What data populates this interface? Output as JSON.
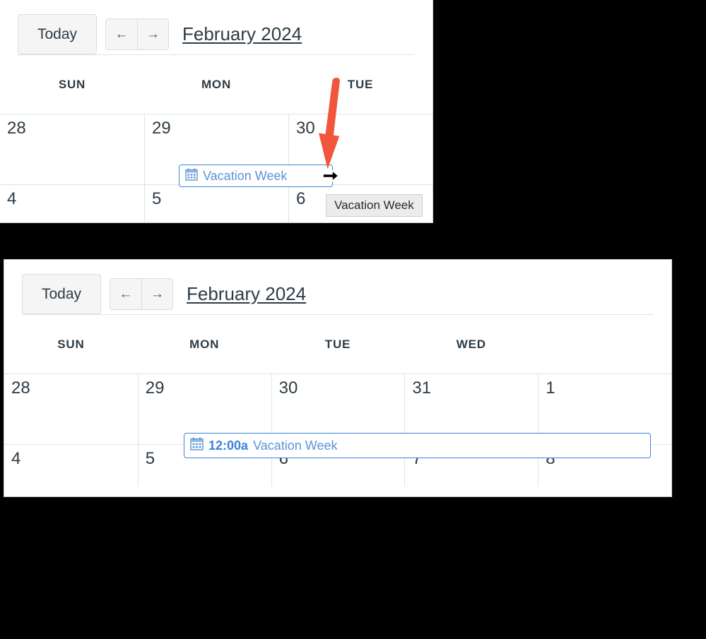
{
  "panels": {
    "top": {
      "toolbar": {
        "today_label": "Today",
        "prev_label": "←",
        "next_label": "→",
        "title": "February 2024"
      },
      "weekdays": [
        "SUN",
        "MON",
        "TUE"
      ],
      "weeks": [
        {
          "days": [
            "28",
            "29",
            "30"
          ]
        },
        {
          "days": [
            "4",
            "5",
            "6"
          ]
        }
      ],
      "event": {
        "icon": "calendar-icon",
        "title": "Vacation Week",
        "border_color": "#3b84d8",
        "text_color": "#5c94d6"
      },
      "tooltip": {
        "text": "Vacation Week"
      },
      "cursor": {
        "icon": "resize-right-arrow-icon"
      },
      "annotation": {
        "icon": "red-down-arrow-icon",
        "color": "#f1563c"
      }
    },
    "bottom": {
      "toolbar": {
        "today_label": "Today",
        "prev_label": "←",
        "next_label": "→",
        "title": "February 2024"
      },
      "weekdays": [
        "SUN",
        "MON",
        "TUE",
        "WED"
      ],
      "weeks": [
        {
          "days": [
            "28",
            "29",
            "30",
            "31",
            "1"
          ]
        },
        {
          "days": [
            "4",
            "5",
            "6",
            "7",
            "8"
          ]
        }
      ],
      "event": {
        "icon": "calendar-icon",
        "time": "12:00a",
        "title": "Vacation Week",
        "border_color": "#3b84d8",
        "text_color": "#5c94d6"
      }
    }
  }
}
